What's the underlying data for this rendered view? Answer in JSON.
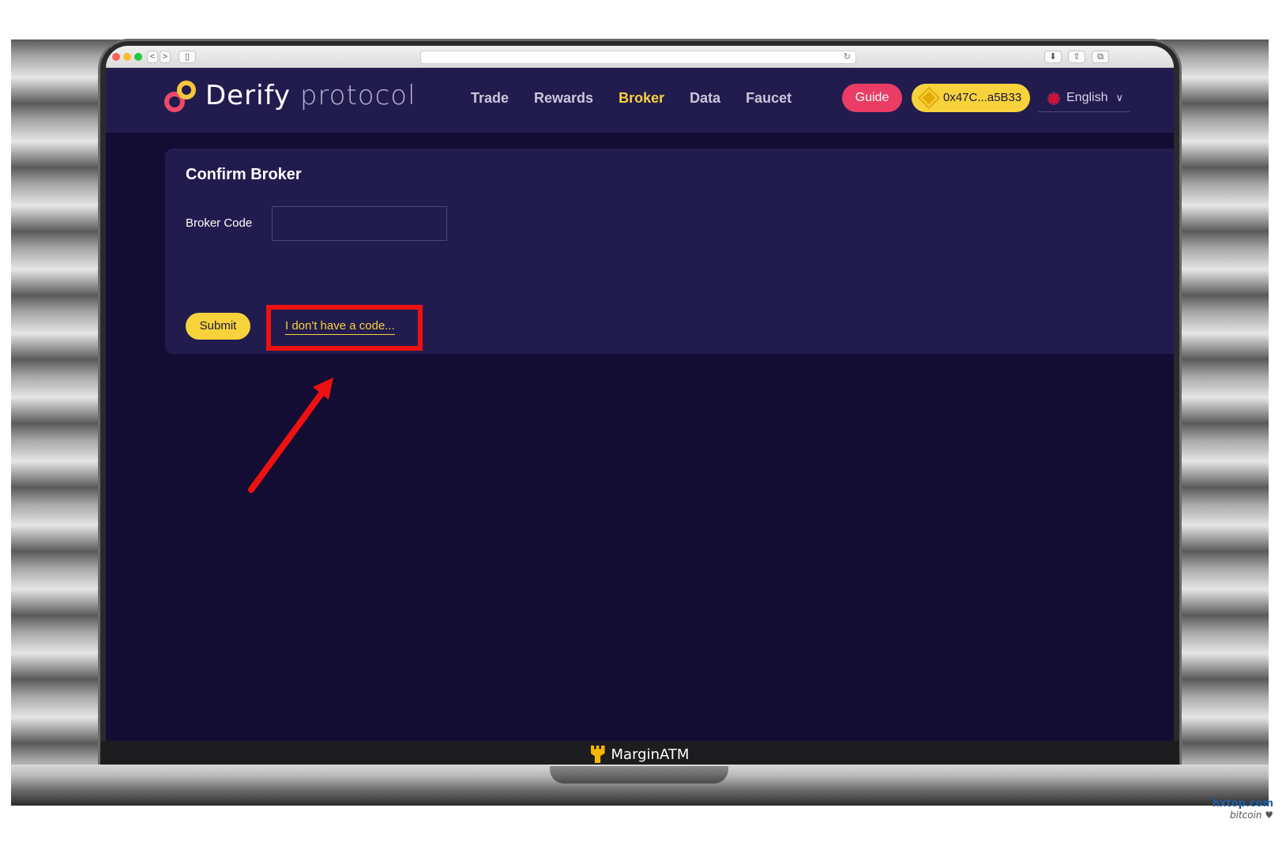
{
  "browser": {
    "back_label": "<",
    "forward_label": ">",
    "sidebar_label": "▯",
    "reload_label": "↻",
    "download_label": "⬇",
    "share_label": "⇧",
    "tabs_label": "⧉"
  },
  "header": {
    "logo_word": "Derify",
    "logo_suffix": "protocol",
    "nav": [
      {
        "label": "Trade",
        "active": false
      },
      {
        "label": "Rewards",
        "active": false
      },
      {
        "label": "Broker",
        "active": true
      },
      {
        "label": "Data",
        "active": false
      },
      {
        "label": "Faucet",
        "active": false
      }
    ],
    "guide_label": "Guide",
    "wallet_label": "0x47C...a5B33",
    "language_label": "English",
    "language_chevron": "∨"
  },
  "card": {
    "title": "Confirm Broker",
    "broker_code_label": "Broker Code",
    "broker_code_value": "",
    "submit_label": "Submit",
    "no_code_label": "I don't have a code..."
  },
  "laptop": {
    "brand": "MarginATM"
  },
  "watermark": {
    "line1": "hxtop.com",
    "line2": "bitcoin ♥"
  },
  "colors": {
    "page_bg": "#140d33",
    "panel_bg": "#221c4e",
    "accent_yellow": "#f7d23b",
    "guide_pink": "#ea3c64",
    "annotation_red": "#ee1111"
  }
}
